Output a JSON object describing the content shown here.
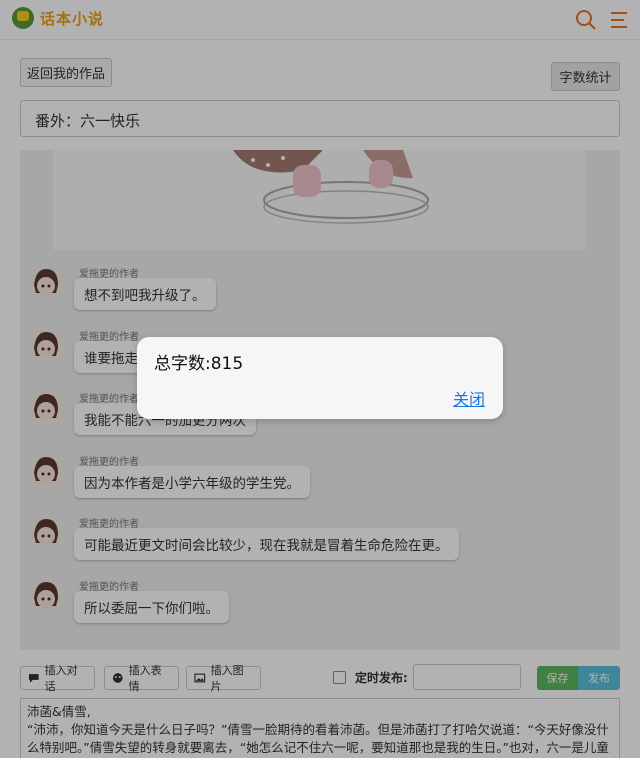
{
  "app": {
    "logo_text": "话本小说"
  },
  "header": {
    "back_label": "返回我的作品",
    "word_count_label": "字数统计",
    "chapter_title": "番外：六一快乐"
  },
  "messages": [
    {
      "author": "爱拖更的作者",
      "text": "想不到吧我升级了。"
    },
    {
      "author": "爱拖更的作者",
      "text": "谁要拖走小"
    },
    {
      "author": "爱拖更的作者",
      "text": "我能不能六一的加更分两次"
    },
    {
      "author": "爱拖更的作者",
      "text": "因为本作者是小学六年级的学生党。"
    },
    {
      "author": "爱拖更的作者",
      "text": "可能最近更文时间会比较少，现在我就是冒着生命危险在更。"
    },
    {
      "author": "爱拖更的作者",
      "text": "所以委屈一下你们啦。"
    }
  ],
  "toolbar": {
    "insert_dialog": "插入对话",
    "insert_emoji": "插入表情",
    "insert_image": "插入图片",
    "schedule_label": "定时发布:",
    "save_label": "保存",
    "publish_label": "发布"
  },
  "editor": {
    "line1": "沛菡&倩雪,",
    "line2": "“沛沛，你知道今天是什么日子吗？”倩雪一脸期待的看着沛菡。但是沛菡打了打哈欠说道：“今天好像没什么特别吧。”倩雪失望的转身就要离去，“她怎么记不住六一呢，要知道那也是我的生日。”也对，六一是儿童节应该很少有"
  },
  "dialog": {
    "message": "总字数:815",
    "close_label": "关闭"
  },
  "colors": {
    "brand_green": "#5b9a3a",
    "brand_yellow": "#e8a317",
    "accent_orange": "#e8702a",
    "save_green": "#5cb85c",
    "publish_blue": "#5bc0de",
    "link_blue": "#1a73e8"
  }
}
